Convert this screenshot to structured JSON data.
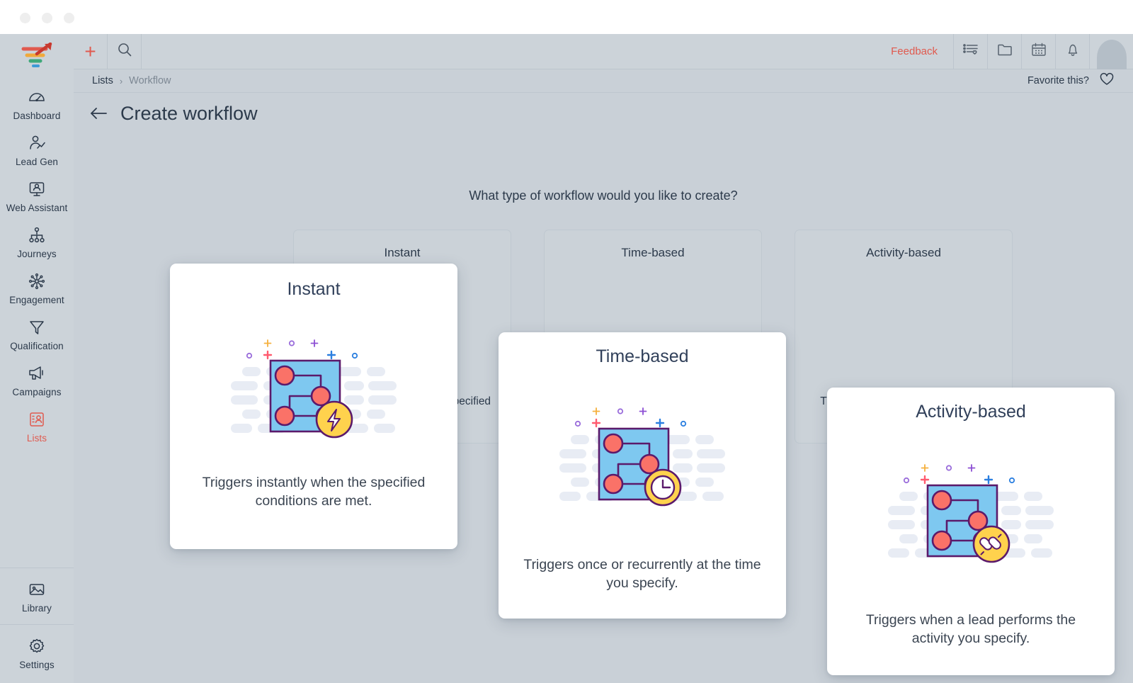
{
  "window": {
    "dots": [
      "close",
      "minimize",
      "maximize"
    ]
  },
  "sidebar": {
    "logo_name": "growth-arrow-logo",
    "items": [
      {
        "label": "Dashboard",
        "icon": "gauge-icon",
        "active": false
      },
      {
        "label": "Lead Gen",
        "icon": "lead-gen-icon",
        "active": false
      },
      {
        "label": "Web Assistant",
        "icon": "web-assistant-icon",
        "active": false
      },
      {
        "label": "Journeys",
        "icon": "journeys-icon",
        "active": false
      },
      {
        "label": "Engagement",
        "icon": "engagement-icon",
        "active": false
      },
      {
        "label": "Qualification",
        "icon": "funnel-icon",
        "active": false
      },
      {
        "label": "Campaigns",
        "icon": "megaphone-icon",
        "active": false
      },
      {
        "label": "Lists",
        "icon": "lists-icon",
        "active": true
      }
    ],
    "bottom_items": [
      {
        "label": "Library",
        "icon": "image-icon"
      },
      {
        "label": "Settings",
        "icon": "gear-icon"
      }
    ],
    "active_color": "#e05a4f",
    "background": "#ccd3d9"
  },
  "topbar": {
    "add_label": "+",
    "search_icon": "search-icon",
    "feedback_label": "Feedback",
    "feedback_color": "#e05a4f",
    "icons": [
      "list-heart-icon",
      "folder-icon",
      "calendar-icon",
      "bell-icon"
    ],
    "avatar_name": "user-avatar"
  },
  "breadcrumb": {
    "items": [
      "Lists",
      "Workflow"
    ],
    "separator": "›",
    "favorite_label": "Favorite this?",
    "favorite_icon": "heart-icon"
  },
  "page": {
    "back_icon": "back-arrow-icon",
    "title": "Create workflow",
    "question": "What type of workflow would you like to create?"
  },
  "cards": [
    {
      "id": "instant",
      "title": "Instant",
      "description": "Triggers instantly when the specified conditions are met.",
      "badge_icon": "lightning-bolt-icon"
    },
    {
      "id": "time-based",
      "title": "Time-based",
      "description": "Triggers once or recurrently at the time you specify.",
      "badge_icon": "clock-icon"
    },
    {
      "id": "activity-based",
      "title": "Activity-based",
      "description": "Triggers when a lead performs the activity you specify.",
      "badge_icon": "plug-connector-icon"
    }
  ],
  "ghost_cards": [
    {
      "title": "Instant",
      "description": "Triggers instantly when the specified conditions are met."
    },
    {
      "title": "Time-based",
      "description": "Triggers once or recurrently at the time you specify."
    },
    {
      "title": "Activity-based",
      "description": "Triggers when a lead performs the activity you specify."
    }
  ],
  "colors": {
    "accent": "#e05a4f",
    "chrome": "#ccd3d9",
    "canvas": "#c9d0d7",
    "text": "#2c3a4b",
    "art_blue": "#7ec8f0",
    "art_outline": "#5b1a6b",
    "art_pink": "#fa7268",
    "art_yellow": "#ffd24d"
  }
}
